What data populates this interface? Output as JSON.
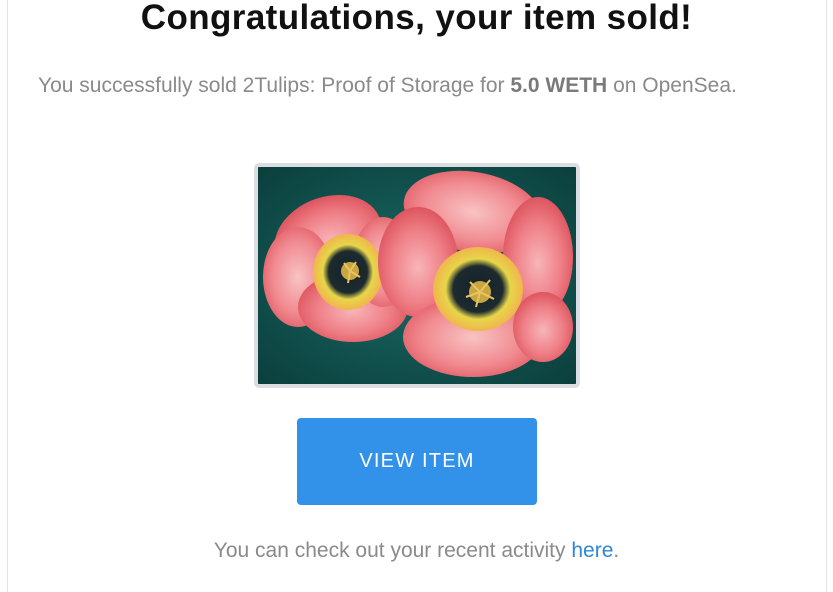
{
  "email": {
    "headline": "Congratulations, your item sold!",
    "message": {
      "prefix": "You successfully sold ",
      "item_name": "2Tulips: Proof of Storage",
      "middle": " for ",
      "price": "5.0 WETH",
      "suffix": " on OpenSea."
    },
    "item_image": {
      "alt": "2Tulips: Proof of Storage"
    },
    "cta_button": {
      "label": "VIEW ITEM"
    },
    "footer": {
      "prefix": "You can check out your recent activity ",
      "link_text": "here",
      "suffix": "."
    }
  },
  "colors": {
    "button_bg": "#3291e9",
    "link": "#2f86d6",
    "body_text": "#8a8a8a",
    "headline": "#111111"
  }
}
